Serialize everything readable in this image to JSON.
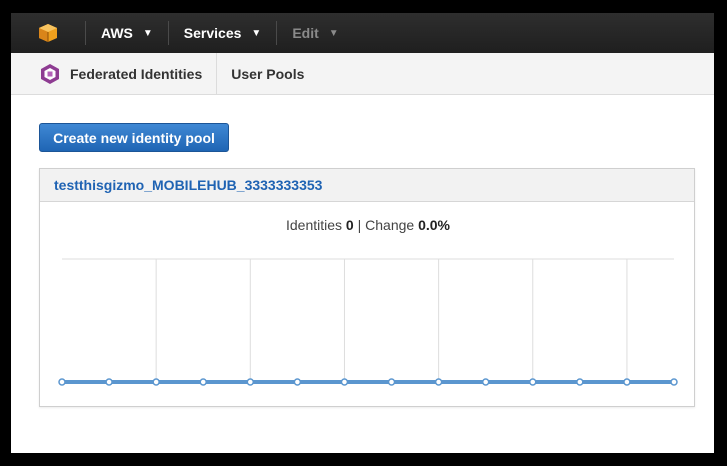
{
  "topbar": {
    "nav": [
      {
        "label": "AWS"
      },
      {
        "label": "Services"
      },
      {
        "label": "Edit"
      }
    ],
    "logo_color": "#f0a01d"
  },
  "subnav": {
    "federated_label": "Federated Identities",
    "user_pools_label": "User Pools"
  },
  "actions": {
    "create_label": "Create new identity pool"
  },
  "pool": {
    "name": "testthisgizmo_MOBILEHUB_3333333353",
    "identities_label": "Identities",
    "identities_value": "0",
    "separator": "|",
    "change_label": "Change",
    "change_value": "0.0%"
  },
  "chart_data": {
    "type": "line",
    "x": [
      1,
      2,
      3,
      4,
      5,
      6,
      7,
      8,
      9,
      10,
      11,
      12,
      13,
      14
    ],
    "series": [
      {
        "values": [
          0,
          0,
          0,
          0,
          0,
          0,
          0,
          0,
          0,
          0,
          0,
          0,
          0,
          0
        ]
      }
    ],
    "ylim": [
      0,
      1
    ],
    "grid": true,
    "line_color": "#5b96cf"
  }
}
